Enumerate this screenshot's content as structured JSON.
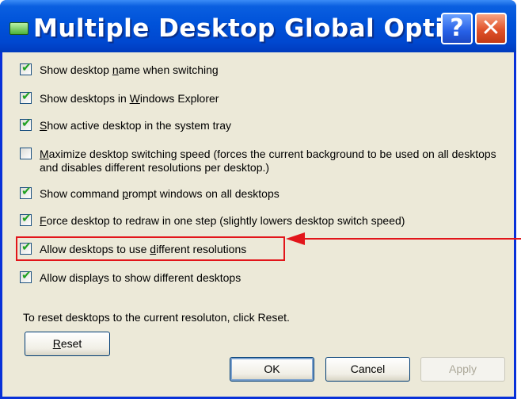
{
  "window": {
    "title": "Multiple Desktop Global Opti...",
    "help_label": "?",
    "close_label": "✕"
  },
  "options": [
    {
      "checked": true,
      "before": "Show desktop ",
      "mnemonic": "n",
      "after": "ame when switching"
    },
    {
      "checked": true,
      "before": "Show desktops in ",
      "mnemonic": "W",
      "after": "indows Explorer"
    },
    {
      "checked": true,
      "before": "",
      "mnemonic": "S",
      "after": "how active desktop in the system tray"
    },
    {
      "checked": false,
      "before": "",
      "mnemonic": "M",
      "after": "aximize desktop switching speed (forces the current background to be used on all desktops and disables different resolutions per desktop.)"
    },
    {
      "checked": true,
      "before": "Show command ",
      "mnemonic": "p",
      "after": "rompt windows on all desktops"
    },
    {
      "checked": true,
      "before": "",
      "mnemonic": "F",
      "after": "orce desktop to redraw in one step (slightly lowers desktop switch speed)"
    },
    {
      "checked": true,
      "before": "Allow desktops to use ",
      "mnemonic": "d",
      "after": "ifferent resolutions"
    },
    {
      "checked": true,
      "before": "Allow displays to show different desktops",
      "mnemonic": "",
      "after": ""
    }
  ],
  "hint": "To reset desktops to the current resoluton, click Reset.",
  "buttons": {
    "reset_mnemonic": "R",
    "reset_rest": "eset",
    "ok": "OK",
    "cancel": "Cancel",
    "apply": "Apply"
  },
  "colors": {
    "annotation": "#e2151a",
    "titlebar": "#0052d9",
    "dialog_bg": "#ece9d8"
  }
}
